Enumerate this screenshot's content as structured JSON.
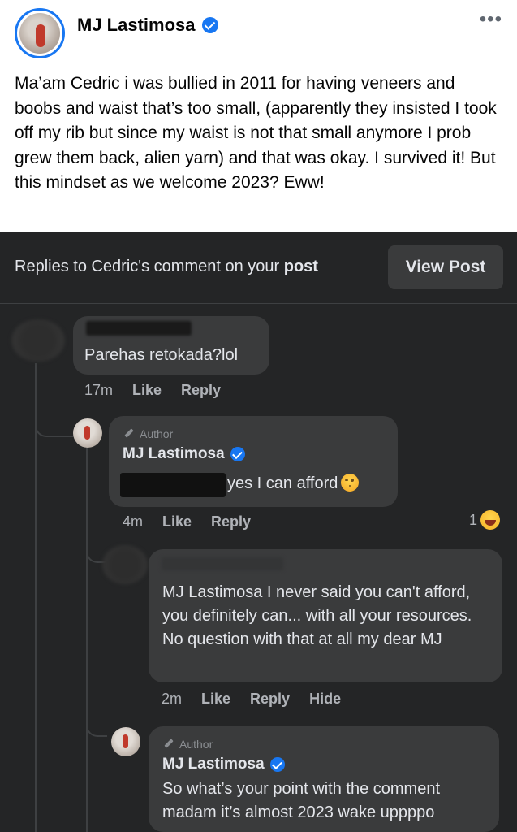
{
  "post": {
    "author": "MJ Lastimosa",
    "more": "•••",
    "text": "Ma’am Cedric i was bullied in 2011 for having veneers and boobs and waist that’s too small, (apparently they insisted I took off my rib but since my waist is not that small anymore I prob grew them back, alien yarn) and that was okay. I survived it! But this mindset as we welcome 2023? Eww!"
  },
  "header": {
    "prefix": "Replies to Cedric's comment on your ",
    "post_word": "post",
    "view_post": "View Post"
  },
  "comments": [
    {
      "text": "Parehas retokada?lol",
      "time": "17m",
      "like": "Like",
      "reply": "Reply"
    },
    {
      "author_tag": "Author",
      "name": "MJ Lastimosa",
      "text": "yes I can afford",
      "emoji": "wink-emoji",
      "time": "4m",
      "like": "Like",
      "reply": "Reply",
      "reaction_count": "1"
    },
    {
      "text": "MJ Lastimosa I never said you can't afford, you definitely can... with all your resources. No question with that at all my dear MJ",
      "time": "2m",
      "like": "Like",
      "reply": "Reply",
      "hide": "Hide"
    },
    {
      "author_tag": "Author",
      "name": "MJ Lastimosa",
      "text": "So what’s your point with the comment madam it’s almost 2023 wake uppppo"
    }
  ],
  "colors": {
    "verified": "#1877f2",
    "dark_bg": "#242526",
    "bubble": "#3a3b3c"
  }
}
